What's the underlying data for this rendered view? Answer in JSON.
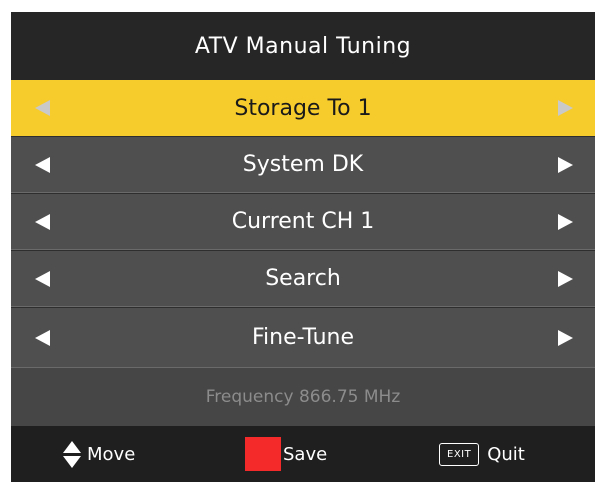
{
  "title": "ATV Manual Tuning",
  "menu": {
    "items": [
      {
        "label": "Storage To 1",
        "selected": true
      },
      {
        "label": "System DK",
        "selected": false
      },
      {
        "label": "Current CH 1",
        "selected": false
      },
      {
        "label": "Search",
        "selected": false
      },
      {
        "label": "Fine-Tune",
        "selected": false
      }
    ]
  },
  "frequency": "Frequency 866.75 MHz",
  "footer": {
    "move_label": "Move",
    "save_label": "Save",
    "exit_key": "EXIT",
    "quit_label": "Quit"
  },
  "colors": {
    "highlight": "#f6cb2c",
    "row_bg": "#4f4f4f",
    "save_key": "#f42a2a"
  },
  "icons": {
    "left": "triangle-left-icon",
    "right": "triangle-right-icon",
    "move": "up-down-arrows-icon"
  }
}
